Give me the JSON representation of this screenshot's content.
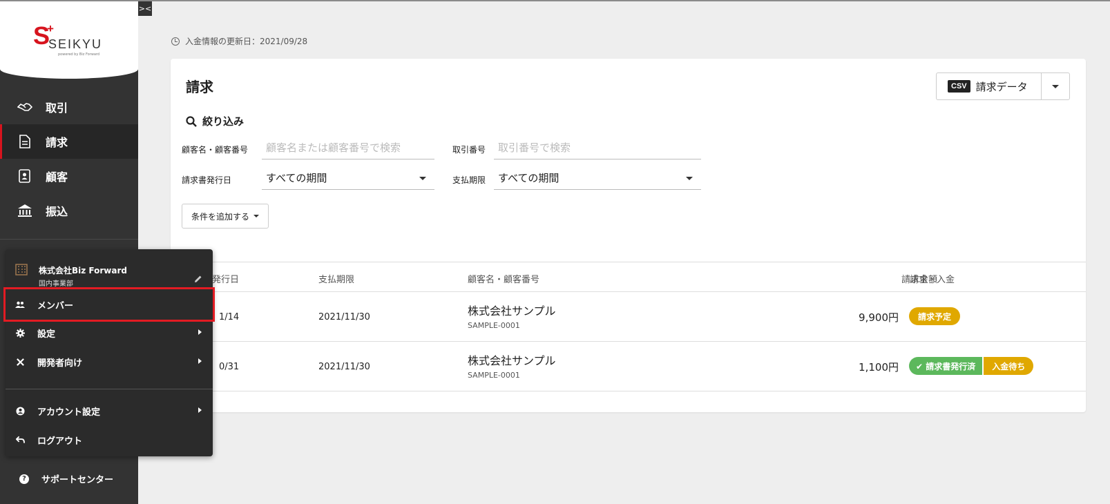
{
  "app": {
    "logo_text": "SEIKYU",
    "logo_powered": "powered by Biz Forward",
    "collapse_icon": "chevrons-icon"
  },
  "sidebar": {
    "items": [
      {
        "label": "取引",
        "icon": "handshake-icon"
      },
      {
        "label": "請求",
        "icon": "document-icon",
        "active": true
      },
      {
        "label": "顧客",
        "icon": "contact-icon"
      },
      {
        "label": "振込",
        "icon": "bank-icon"
      }
    ],
    "support_label": "サポートセンター"
  },
  "popup": {
    "org_name": "株式会社Biz Forward",
    "org_dept": "国内事業部",
    "items": [
      {
        "label": "メンバー",
        "icon": "people-icon",
        "highlighted": true
      },
      {
        "label": "設定",
        "icon": "gear-icon",
        "submenu": true
      },
      {
        "label": "開発者向け",
        "icon": "tools-icon",
        "submenu": true
      },
      {
        "label": "アカウント設定",
        "icon": "account-icon",
        "submenu": true
      },
      {
        "label": "ログアウト",
        "icon": "logout-icon"
      }
    ]
  },
  "main": {
    "updated_text": "入金情報の更新日：2021/09/28",
    "title": "請求",
    "csv_badge": "CSV",
    "csv_label": "請求データ",
    "filter_title": "絞り込み",
    "filters": {
      "customer_label": "顧客名・顧客番号",
      "customer_placeholder": "顧客名または顧客番号で検索",
      "trade_label": "取引番号",
      "trade_placeholder": "取引番号で検索",
      "issue_label": "請求書発行日",
      "issue_value": "すべての期間",
      "due_label": "支払期限",
      "due_value": "すべての期間",
      "add_condition": "条件を追加する"
    },
    "table": {
      "headers": {
        "issue": "発行日",
        "due": "支払期限",
        "customer": "顧客名・顧客番号",
        "amount": "請求金額",
        "status": "請求・入金"
      },
      "rows": [
        {
          "issue": "1/14",
          "due": "2021/11/30",
          "customer_name": "株式会社サンプル",
          "customer_no": "SAMPLE-0001",
          "amount": "9,900円",
          "status1": "請求予定"
        },
        {
          "issue": "0/31",
          "due": "2021/11/30",
          "customer_name": "株式会社サンプル",
          "customer_no": "SAMPLE-0001",
          "amount": "1,100円",
          "status1": "✔ 請求書発行済",
          "status2": "入金待ち"
        }
      ]
    }
  },
  "colors": {
    "brand_red": "#d7141e",
    "sidebar": "#333333",
    "pill_yellow": "#e0a800",
    "pill_green": "#5cb85c"
  }
}
